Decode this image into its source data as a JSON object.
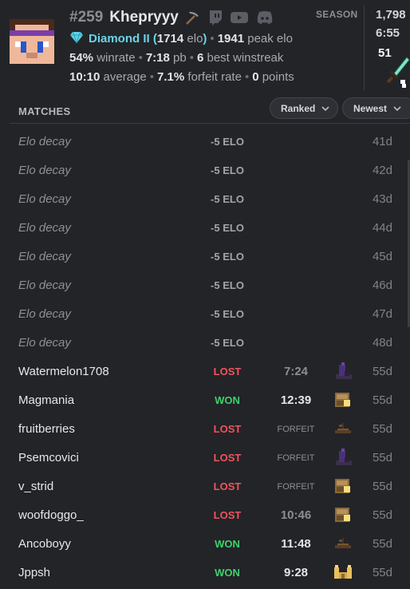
{
  "profile": {
    "rank": "#259",
    "username": "Khepryyy",
    "tier": "Diamond II",
    "elo_value": "1714",
    "elo_word": "elo",
    "peak_elo": "1941",
    "peak_label": "peak elo",
    "winrate": "54%",
    "winrate_label": "winrate",
    "pb": "7:18",
    "pb_label": "pb",
    "winstreak": "6",
    "winstreak_label": "best winstreak",
    "average": "10:10",
    "average_label": "average",
    "forfeit_rate": "7.1%",
    "forfeit_label": "forfeit rate",
    "points": "0",
    "points_label": "points"
  },
  "season": {
    "label": "SEASON",
    "value1": "1,798",
    "value2": "6:55",
    "count": "51"
  },
  "matches": {
    "title": "MATCHES",
    "filter_ranked": "Ranked",
    "sort_newest": "Newest"
  },
  "rows": [
    {
      "name": "Elo decay",
      "result": "-5 ELO",
      "age": "41d"
    },
    {
      "name": "Elo decay",
      "result": "-5 ELO",
      "age": "42d"
    },
    {
      "name": "Elo decay",
      "result": "-5 ELO",
      "age": "43d"
    },
    {
      "name": "Elo decay",
      "result": "-5 ELO",
      "age": "44d"
    },
    {
      "name": "Elo decay",
      "result": "-5 ELO",
      "age": "45d"
    },
    {
      "name": "Elo decay",
      "result": "-5 ELO",
      "age": "46d"
    },
    {
      "name": "Elo decay",
      "result": "-5 ELO",
      "age": "47d"
    },
    {
      "name": "Elo decay",
      "result": "-5 ELO",
      "age": "48d"
    },
    {
      "name": "Watermelon1708",
      "result": "LOST",
      "time": "7:24",
      "age": "55d"
    },
    {
      "name": "Magmania",
      "result": "WON",
      "time": "12:39",
      "age": "55d"
    },
    {
      "name": "fruitberries",
      "result": "LOST",
      "time": "FORFEIT",
      "age": "55d"
    },
    {
      "name": "Psemcovici",
      "result": "LOST",
      "time": "FORFEIT",
      "age": "55d"
    },
    {
      "name": "v_strid",
      "result": "LOST",
      "time": "FORFEIT",
      "age": "55d"
    },
    {
      "name": "woofdoggo_",
      "result": "LOST",
      "time": "10:46",
      "age": "55d"
    },
    {
      "name": "Ancoboyy",
      "result": "WON",
      "time": "11:48",
      "age": "55d"
    },
    {
      "name": "Jppsh",
      "result": "WON",
      "time": "9:28",
      "age": "55d"
    }
  ],
  "colors": {
    "background": "#232428",
    "won": "#3fd16a",
    "lost": "#f0545b",
    "diamond": "#6bd4e6"
  },
  "icons": {
    "pickaxe": "pickaxe-icon",
    "twitch": "twitch-icon",
    "youtube": "youtube-icon",
    "discord": "discord-icon",
    "diamond": "diamond-icon",
    "chevron": "chevron-down-icon",
    "seeds": [
      "bastion-icon",
      "village-icon",
      "shipwreck-icon",
      "temple-icon"
    ]
  }
}
